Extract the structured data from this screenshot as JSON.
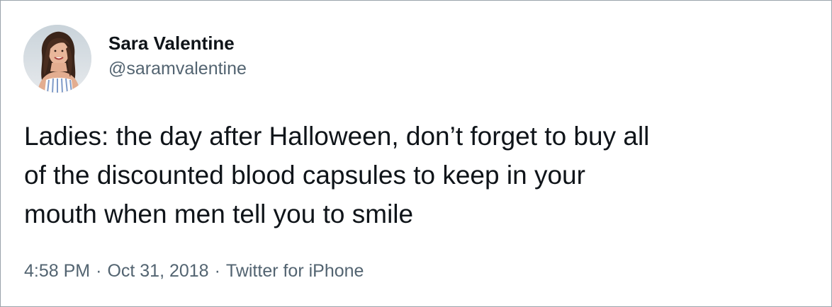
{
  "author": {
    "display_name": "Sara Valentine",
    "handle": "@saramvalentine",
    "avatar_icon": "profile-photo"
  },
  "tweet": {
    "text": "Ladies: the day after Halloween, don’t forget to buy all\nof the discounted blood capsules to keep in your\nmouth when men tell you to smile"
  },
  "meta": {
    "time": "4:58 PM",
    "separator": "·",
    "date": "Oct 31, 2018",
    "source": "Twitter for iPhone"
  },
  "colors": {
    "text_primary": "#0f1419",
    "text_secondary": "#536471",
    "border": "#9aa3ab"
  }
}
